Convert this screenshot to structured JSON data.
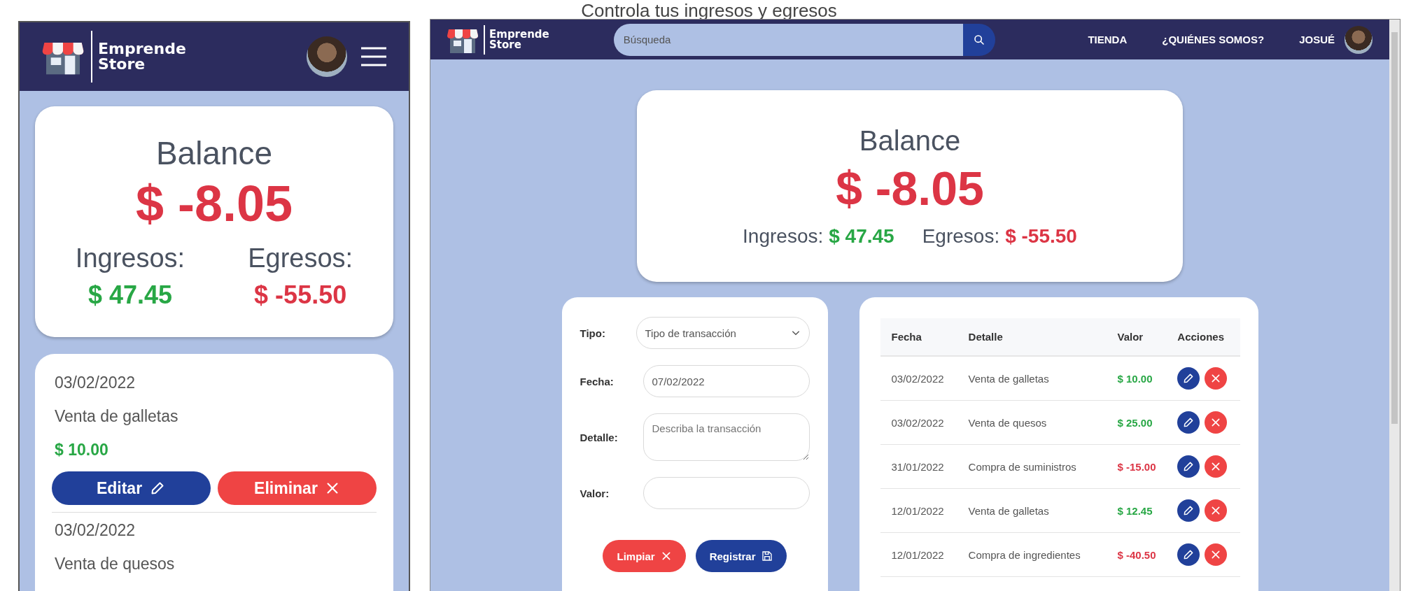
{
  "title": "Controla tus ingresos y egresos",
  "mobile": {
    "brand": [
      "Emprende",
      "Store"
    ],
    "balance": {
      "title": "Balance",
      "amount": "$ -8.05",
      "income_label": "Ingresos:",
      "income_value": "$ 47.45",
      "expense_label": "Egresos:",
      "expense_value": "$ -55.50"
    },
    "transactions": [
      {
        "date": "03/02/2022",
        "detail": "Venta de galletas",
        "value": "$ 10.00",
        "kind": "income",
        "edit_label": "Editar",
        "delete_label": "Eliminar"
      },
      {
        "date": "03/02/2022",
        "detail": "Venta de quesos"
      }
    ]
  },
  "desktop": {
    "brand": [
      "Emprende",
      "Store"
    ],
    "search": {
      "placeholder": "Búsqueda"
    },
    "nav_links": [
      "TIENDA",
      "¿QUIÉNES SOMOS?"
    ],
    "user": "JOSUÉ",
    "balance": {
      "title": "Balance",
      "amount": "$ -8.05",
      "income_label": "Ingresos:",
      "income_value": "$ 47.45",
      "expense_label": "Egresos:",
      "expense_value": "$ -55.50"
    },
    "form": {
      "fields": [
        {
          "label": "Tipo:",
          "kind": "select",
          "placeholder": "Tipo de transacción"
        },
        {
          "label": "Fecha:",
          "kind": "input",
          "value": "07/02/2022"
        },
        {
          "label": "Detalle:",
          "kind": "textarea",
          "placeholder": "Describa la transacción"
        },
        {
          "label": "Valor:",
          "kind": "input"
        }
      ],
      "buttons": [
        {
          "label": "Limpiar",
          "kind": "clear"
        },
        {
          "label": "Registrar",
          "kind": "save"
        }
      ]
    },
    "table": {
      "columns": [
        "Fecha",
        "Detalle",
        "Valor",
        "Acciones"
      ],
      "rows": [
        {
          "date": "03/02/2022",
          "detail": "Venta de galletas",
          "value": "$ 10.00",
          "kind": "income"
        },
        {
          "date": "03/02/2022",
          "detail": "Venta de quesos",
          "value": "$ 25.00",
          "kind": "income"
        },
        {
          "date": "31/01/2022",
          "detail": "Compra de suministros",
          "value": "$ -15.00",
          "kind": "expense"
        },
        {
          "date": "12/01/2022",
          "detail": "Venta de galletas",
          "value": "$ 12.45",
          "kind": "income"
        },
        {
          "date": "12/01/2022",
          "detail": "Compra de ingredientes",
          "value": "$ -40.50",
          "kind": "expense"
        }
      ]
    }
  }
}
